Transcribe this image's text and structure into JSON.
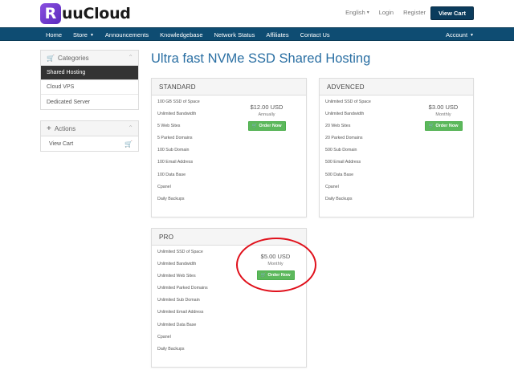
{
  "header": {
    "logo_mark": "R",
    "logo_text": "uuCloud",
    "language": "English",
    "login": "Login",
    "register": "Register",
    "view_cart": "View Cart"
  },
  "nav": {
    "items": [
      "Home",
      "Store",
      "Announcements",
      "Knowledgebase",
      "Network Status",
      "Affiliates",
      "Contact Us"
    ],
    "account": "Account"
  },
  "sidebar": {
    "categories_title": "Categories",
    "categories": [
      "Shared Hosting",
      "Cloud VPS",
      "Dedicated Server"
    ],
    "actions_title": "Actions",
    "actions": [
      "View Cart"
    ]
  },
  "main": {
    "title": "Ultra fast NVMe SSD Shared Hosting",
    "plans": [
      {
        "name": "STANDARD",
        "price": "$12.00 USD",
        "cycle": "Annually",
        "order": "Order Now",
        "features": [
          "100 GB SSD of Space",
          "Unlimited Bandwidth",
          "5 Web Sites",
          "5 Parked Domains",
          "100 Sub Domain",
          "100 Email Address",
          "100 Data Base",
          "Cpanel",
          "Daily Backups"
        ]
      },
      {
        "name": "ADVENCED",
        "price": "$3.00 USD",
        "cycle": "Monthly",
        "order": "Order Now",
        "features": [
          "Unlimited SSD of Space",
          "Unlimited Bandwidth",
          "20 Web Sites",
          "20 Parked Domains",
          "500 Sub Domain",
          "500 Email Address",
          "500 Data Base",
          "Cpanel",
          "Daily Backups"
        ]
      },
      {
        "name": "PRO",
        "price": "$5.00 USD",
        "cycle": "Monthly",
        "order": "Order Now",
        "features": [
          "Unlimited SSD of Space",
          "Unlimited Bandwidth",
          "Unlimited Web Sites",
          "Unlimited Parked Domains",
          "Unlimited Sub Domain",
          "Unlimited Email Address",
          "Unlimited Data Base",
          "Cpanel",
          "Daily Backups"
        ]
      }
    ]
  },
  "colors": {
    "nav": "#0e4c72",
    "title": "#2a6fa3",
    "order_button": "#5cb85c",
    "annotation": "#e0101b"
  }
}
